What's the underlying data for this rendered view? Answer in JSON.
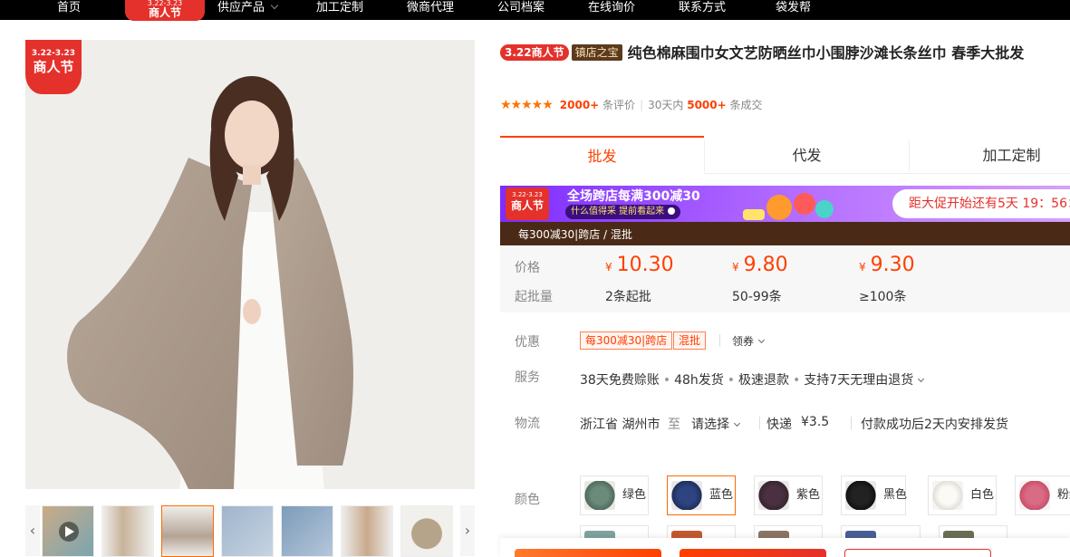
{
  "nav": {
    "items": [
      "首页",
      "供应产品",
      "加工定制",
      "微商代理",
      "公司档案",
      "在线询价",
      "联系方式",
      "袋发帮"
    ],
    "festival": {
      "dates": "3.22-3.23",
      "label": "商人节"
    }
  },
  "gallery": {
    "badge": {
      "dates": "3.22-3.23",
      "label": "商人节"
    },
    "prev_icon": "chevron-left-icon",
    "next_icon": "chevron-right-icon",
    "active_thumb_index": 2
  },
  "product": {
    "fest_tag": "3.22商人节",
    "shop_tag": "镇店之宝",
    "title": "纯色棉麻围巾女文艺防晒丝巾小围脖沙滩长条丝巾 春季大批发"
  },
  "rating": {
    "stars": "★★★★★",
    "review_count": "2000+",
    "review_suffix": "条评价",
    "period": "30天内",
    "deal_count": "5000+",
    "deal_suffix": "条成交"
  },
  "tabs": [
    "批发",
    "代发",
    "加工定制"
  ],
  "promo": {
    "fest_dates": "3.22-3.23",
    "fest_label": "商人节",
    "headline": "全场跨店每满300减30",
    "sub": "什么值得采 提前看起来",
    "countdown": "距大促开始还有5天 19：56：",
    "strip": "每300减30|跨店 / 混批"
  },
  "price": {
    "price_label": "价格",
    "qty_label": "起批量",
    "currency": "¥",
    "tiers": [
      {
        "price": "10.30",
        "qty": "2条起批"
      },
      {
        "price": "9.80",
        "qty": "50-99条"
      },
      {
        "price": "9.30",
        "qty": "≥100条"
      }
    ]
  },
  "offers": {
    "label": "优惠",
    "coupons": [
      "每300减30|跨店",
      "混批"
    ],
    "get_coupon": "领券"
  },
  "service": {
    "label": "服务",
    "items": [
      "38天免费赊账",
      "48h发货",
      "极速退款",
      "支持7天无理由退货"
    ]
  },
  "logistics": {
    "label": "物流",
    "origin": "浙江省 湖州市",
    "to": "至",
    "dest": "请选择",
    "method": "快递",
    "fee": "¥3.5",
    "note": "付款成功后2天内安排发货"
  },
  "colors": {
    "label": "颜色",
    "options": [
      {
        "name": "绿色",
        "swatch": "#4f6b5c"
      },
      {
        "name": "蓝色",
        "swatch": "#1f2f5c"
      },
      {
        "name": "紫色",
        "swatch": "#3a2530"
      },
      {
        "name": "黑色",
        "swatch": "#111111"
      },
      {
        "name": "白色",
        "swatch": "#f1efe9"
      },
      {
        "name": "粉红",
        "swatch": "#c94f6a"
      }
    ],
    "selected": "蓝色"
  }
}
